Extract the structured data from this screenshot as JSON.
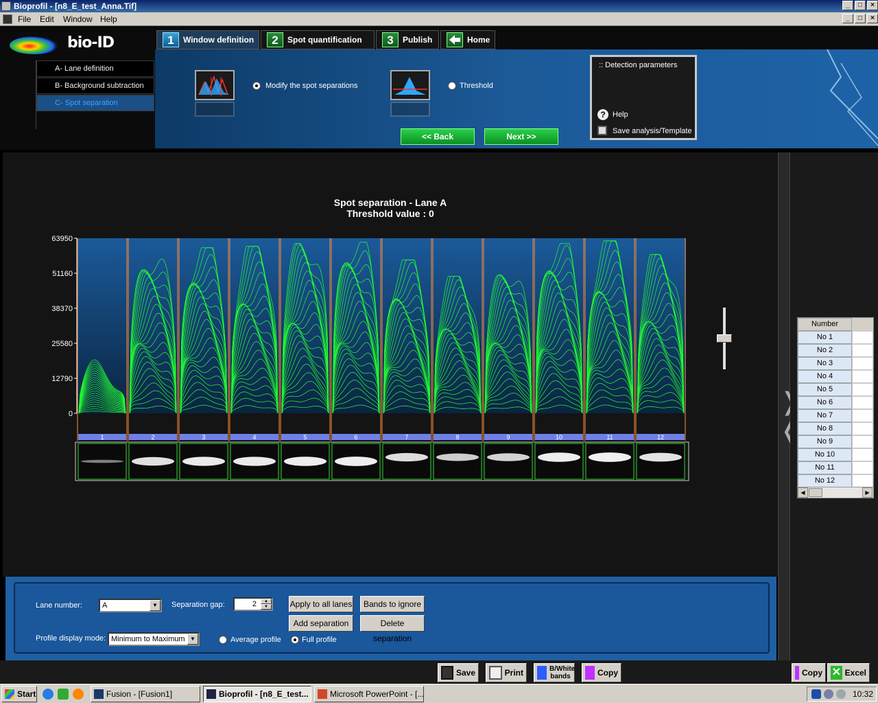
{
  "window": {
    "title": "Bioprofil - [n8_E_test_Anna.Tif]"
  },
  "menu": [
    "File",
    "Edit",
    "Window",
    "Help"
  ],
  "logo": {
    "text": "bio-ID"
  },
  "nav": {
    "items": [
      "A- Lane definition",
      "B- Background subtraction",
      "C- Spot separation"
    ],
    "selected": 2
  },
  "tabs": [
    {
      "num": "1",
      "label": "Window definition"
    },
    {
      "num": "2",
      "label": "Spot quantification"
    },
    {
      "num": "3",
      "label": "Publish"
    },
    {
      "num": "",
      "label": "Home"
    }
  ],
  "options": {
    "modify_label": "Modify the spot separations",
    "threshold_label": "Threshold",
    "selected": "modify"
  },
  "buttons": {
    "back": "<< Back",
    "next": "Next >>"
  },
  "detection": {
    "title": ":: Detection parameters",
    "help": "Help",
    "save": "Save analysis/Template"
  },
  "chart_data": {
    "type": "line",
    "title": "Spot separation - Lane A",
    "subtitle": "Threshold value : 0",
    "yticks": [
      "63950",
      "51160",
      "38370",
      "25580",
      "12790",
      "0"
    ],
    "ylim": [
      0,
      63950
    ],
    "lanes": [
      "1",
      "2",
      "3",
      "4",
      "5",
      "6",
      "7",
      "8",
      "9",
      "10",
      "11",
      "12"
    ],
    "lane_peak_values": [
      21000,
      57000,
      60500,
      61000,
      62000,
      62500,
      56000,
      50000,
      52000,
      62000,
      63000,
      58000
    ],
    "line_color": "#22ff33",
    "separator_color": "#ff8c3a"
  },
  "number_table": {
    "header": "Number",
    "rows": [
      "No 1",
      "No 2",
      "No 3",
      "No 4",
      "No 5",
      "No 6",
      "No 7",
      "No 8",
      "No 9",
      "No 10",
      "No 11",
      "No 12"
    ]
  },
  "controls": {
    "lane_number_label": "Lane number:",
    "lane_number_value": "A",
    "separation_gap_label": "Separation gap:",
    "separation_gap_value": "2",
    "apply_all": "Apply to all lanes",
    "bands_ignore": "Bands to ignore",
    "add_sep": "Add separation",
    "delete_sep": "Delete separation",
    "profile_mode_label": "Profile display mode:",
    "profile_mode_value": "Minimum to Maximum",
    "avg_profile": "Average profile",
    "full_profile": "Full profile",
    "profile_selected": "full"
  },
  "toolbar": {
    "save": "Save",
    "print": "Print",
    "bw_bands": "B/White bands",
    "copy": "Copy",
    "copy2": "Copy",
    "excel": "Excel"
  },
  "taskbar": {
    "start": "Start",
    "tasks": [
      "Fusion - [Fusion1]",
      "Bioprofil - [n8_E_test...",
      "Microsoft PowerPoint - [..."
    ],
    "clock": "10:32"
  }
}
